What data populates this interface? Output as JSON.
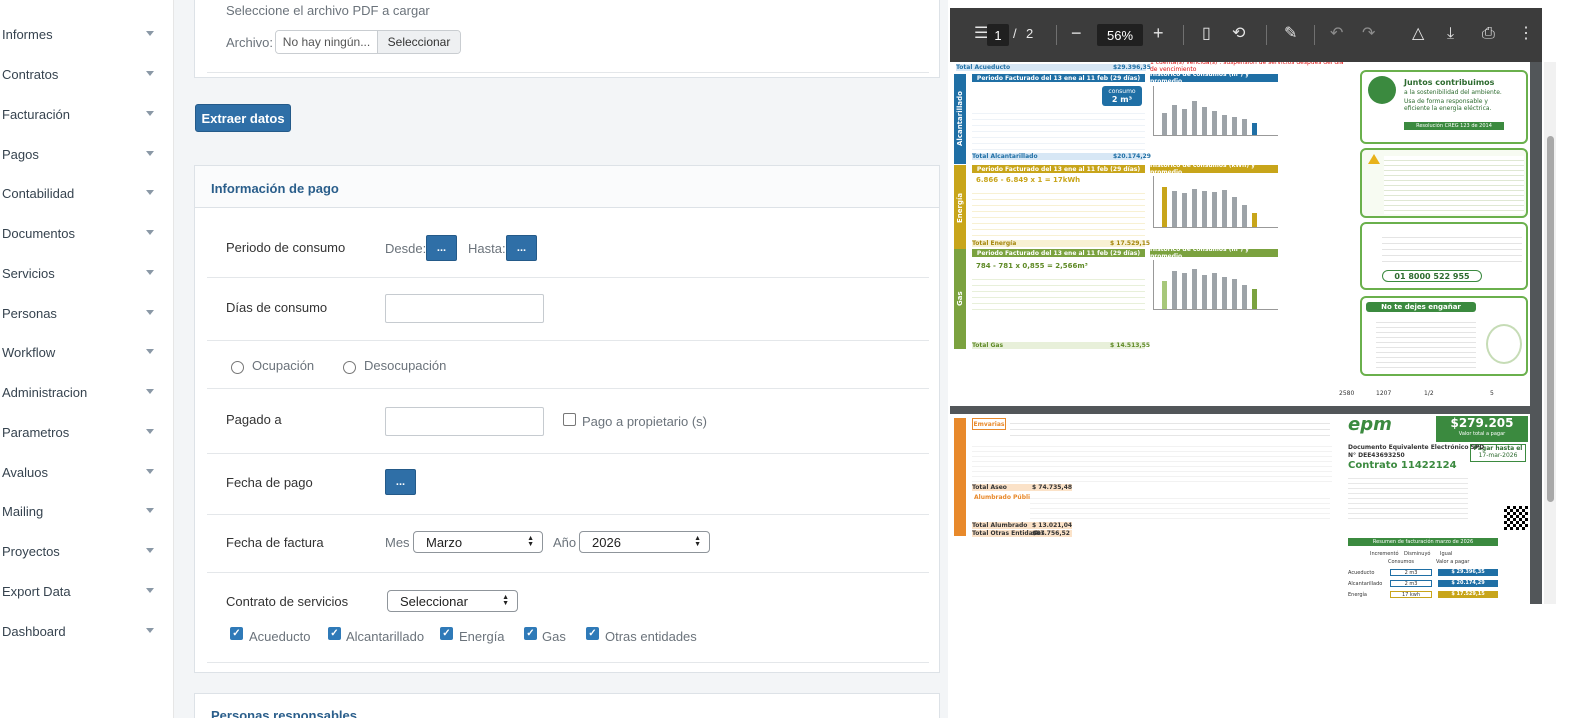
{
  "sidebar": {
    "items": [
      {
        "label": "Informes"
      },
      {
        "label": "Contratos"
      },
      {
        "label": "Facturación"
      },
      {
        "label": "Pagos"
      },
      {
        "label": "Contabilidad"
      },
      {
        "label": "Documentos"
      },
      {
        "label": "Servicios"
      },
      {
        "label": "Personas"
      },
      {
        "label": "Workflow"
      },
      {
        "label": "Administracion"
      },
      {
        "label": "Parametros"
      },
      {
        "label": "Avaluos"
      },
      {
        "label": "Mailing"
      },
      {
        "label": "Proyectos"
      },
      {
        "label": "Export Data"
      },
      {
        "label": "Dashboard"
      }
    ]
  },
  "upload": {
    "instruction": "Seleccione el archivo PDF a cargar",
    "file_label": "Archivo:",
    "file_status": "No hay ningún...",
    "select_button": "Seleccionar"
  },
  "extract_button": "Extraer datos",
  "payment_info": {
    "title": "Información de pago",
    "periodo_label": "Periodo de consumo",
    "desde_label": "Desde:",
    "hasta_label": "Hasta:",
    "dots": "...",
    "dias_label": "Días de consumo",
    "dias_value": "",
    "ocupacion_label": "Ocupación",
    "desocupacion_label": "Desocupación",
    "pagado_label": "Pagado a",
    "pagado_value": "",
    "pago_propietario_label": "Pago a propietario (s)",
    "fecha_pago_label": "Fecha de pago",
    "fecha_factura_label": "Fecha de factura",
    "mes_label": "Mes",
    "mes_value": "Marzo",
    "anio_label": "Año",
    "anio_value": "2026",
    "contrato_label": "Contrato de servicios",
    "contrato_value": "Seleccionar",
    "services": [
      {
        "label": "Acueducto",
        "checked": true
      },
      {
        "label": "Alcantarillado",
        "checked": true
      },
      {
        "label": "Energía",
        "checked": true
      },
      {
        "label": "Gas",
        "checked": true
      },
      {
        "label": "Otras entidades",
        "checked": true
      }
    ]
  },
  "next_card_title": "Personas responsables",
  "pdf_viewer": {
    "page_current": "1",
    "page_total": "2",
    "page_separator": "/",
    "zoom": "56%",
    "icons": [
      "menu-icon",
      "zoom-out-icon",
      "zoom-in-icon",
      "fit-page-icon",
      "rotate-icon",
      "draw-icon",
      "undo-icon",
      "redo-icon",
      "add-drive-icon",
      "download-icon",
      "print-icon",
      "more-icon"
    ],
    "page1": {
      "acueducto_total_label": "Total Acueducto",
      "acueducto_total": "$29.396,35",
      "strips": [
        "Alcantarillado",
        "Energía",
        "Gas"
      ],
      "alc_head": "Periodo Facturado del 13 ene al 11 feb (29 días)",
      "alc_hist": "Histórico de consumos (m³) y promedio",
      "alc_consumo": "consumo",
      "alc_consumo_val": "2 m³",
      "alc_total_label": "Total Alcantarillado",
      "alc_total": "$20.174,29",
      "ene_head": "Periodo Facturado del 13 ene al 11 feb (29 días)",
      "ene_hist": "Histórico de consumos (kWh) y promedio",
      "ene_reading": "6.866 - 6.849 x 1 = 17kWh",
      "ene_total_label": "Total Energía",
      "ene_total": "$ 17.529,15",
      "gas_head": "Periodo Facturado del 13 ene al 11 feb (29 días)",
      "gas_hist": "Histórico de consumos (m³) y promedio",
      "gas_reading": "784 - 781 x 0,855 = 2,566m³",
      "gas_total_label": "Total Gas",
      "gas_total": "$ 14.513,55",
      "suspension_note": "1 cuenta(s) vencida(s) : suspensión de servicios después del día de vencimiento",
      "promo_title": "Juntos contribuimos",
      "promo_sub": "a la sostenibilidad del ambiente.",
      "promo_text": "Usa de forma responsable y eficiente la energía eléctrica.",
      "promo_res": "Resolución CREG 123 de 2014",
      "line_number": "01 8000 522 955",
      "no_engano": "No te dejes engañar",
      "footer": [
        "2580",
        "1207",
        "1/2",
        "5"
      ]
    },
    "page2": {
      "brand": "epm",
      "entity": "Emvarias",
      "amount": "$279.205",
      "amount_label": "Valor total a pagar",
      "pay_until_label": "Pagar hasta el",
      "pay_until_date": "17-mar-2026",
      "doc_type": "Documento Equivalente Electrónico SPD",
      "doc_number": "N° DEE43693250",
      "contract": "Contrato 11422124",
      "aseo_total_label": "Total Aseo",
      "aseo_total": "$ 74.735,48",
      "alumbrado": "Alumbrado Público",
      "alumbrado_total_label": "Total Alumbrado",
      "alumbrado_total": "$ 13.021,04",
      "otras_total_label": "Total Otras Entidades",
      "otras_total": "$87.756,52",
      "summary_title": "Resumen de facturación marzo de 2026",
      "summary_rows": [
        {
          "label": "Acueducto",
          "consumo": "2 m3",
          "valor": "$ 29.396,35"
        },
        {
          "label": "Alcantarillado",
          "consumo": "2 m3",
          "valor": "$ 20.174,29"
        },
        {
          "label": "Energía",
          "consumo": "17 kwh",
          "valor": "$ 17.529,15"
        }
      ],
      "legend": [
        "Incrementó",
        "Disminuyó",
        "Igual"
      ],
      "col_consumos": "Consumos",
      "col_valor": "Valor a pagar"
    }
  },
  "colors": {
    "primary": "#2f6fa7",
    "card_title": "#2a5e8b",
    "acueducto_blue": "#1f6fa5",
    "energia_yellow": "#c8a51a",
    "gas_green": "#7ba23f",
    "epm_green": "#3b8a3f",
    "aseo_orange": "#e8892b"
  }
}
